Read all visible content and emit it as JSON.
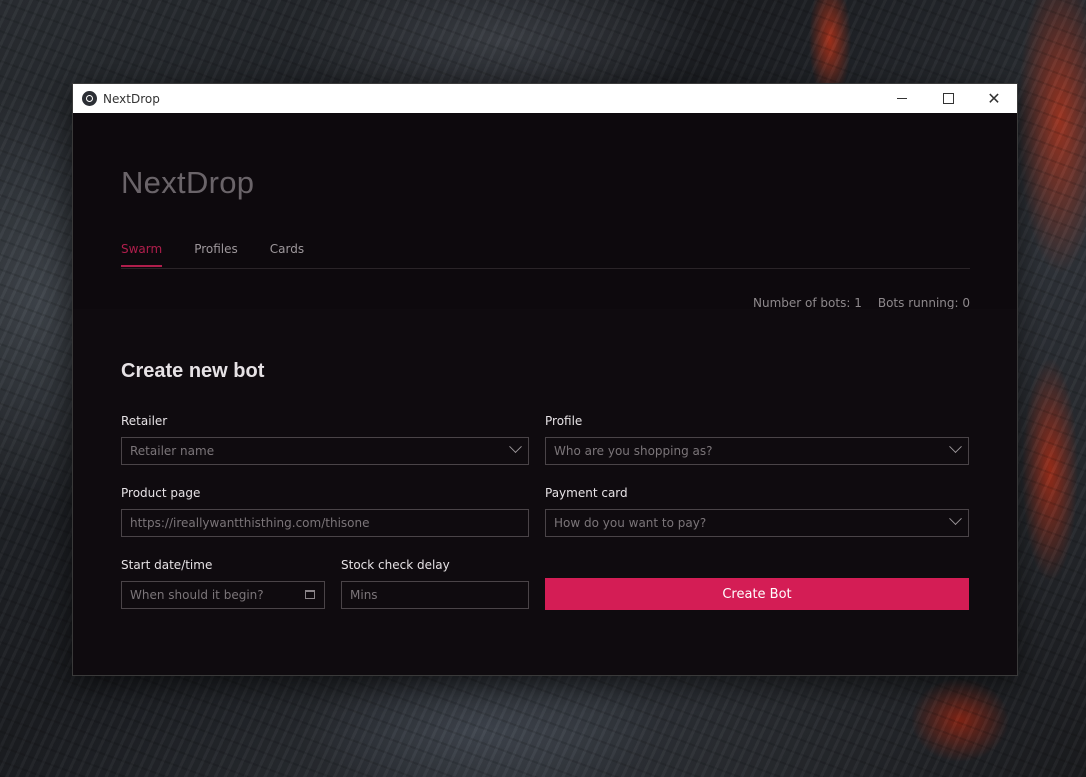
{
  "window": {
    "title": "NextDrop",
    "controls": {
      "minimize_icon": "minimize-icon",
      "maximize_icon": "maximize-icon",
      "close_icon": "close-icon",
      "close_glyph": "✕"
    }
  },
  "header": {
    "app_title": "NextDrop",
    "tabs": [
      {
        "label": "Swarm",
        "active": true
      },
      {
        "label": "Profiles",
        "active": false
      },
      {
        "label": "Cards",
        "active": false
      }
    ],
    "stats": {
      "bots_count": "Number of bots: 1",
      "bots_running": "Bots running: 0"
    }
  },
  "form": {
    "title": "Create new bot",
    "retailer": {
      "label": "Retailer",
      "placeholder": "Retailer name"
    },
    "profile": {
      "label": "Profile",
      "placeholder": "Who are you shopping as?"
    },
    "product_page": {
      "label": "Product page",
      "placeholder": "https://ireallywantthisthing.com/thisone"
    },
    "payment_card": {
      "label": "Payment card",
      "placeholder": "How do you want to pay?"
    },
    "start_datetime": {
      "label": "Start date/time",
      "placeholder": "When should it begin?"
    },
    "stock_delay": {
      "label": "Stock check delay",
      "placeholder": "Mins"
    },
    "submit_label": "Create Bot"
  },
  "colors": {
    "accent": "#d41d55",
    "tab_active": "#b01e4c",
    "background": "#0f0b0f"
  }
}
